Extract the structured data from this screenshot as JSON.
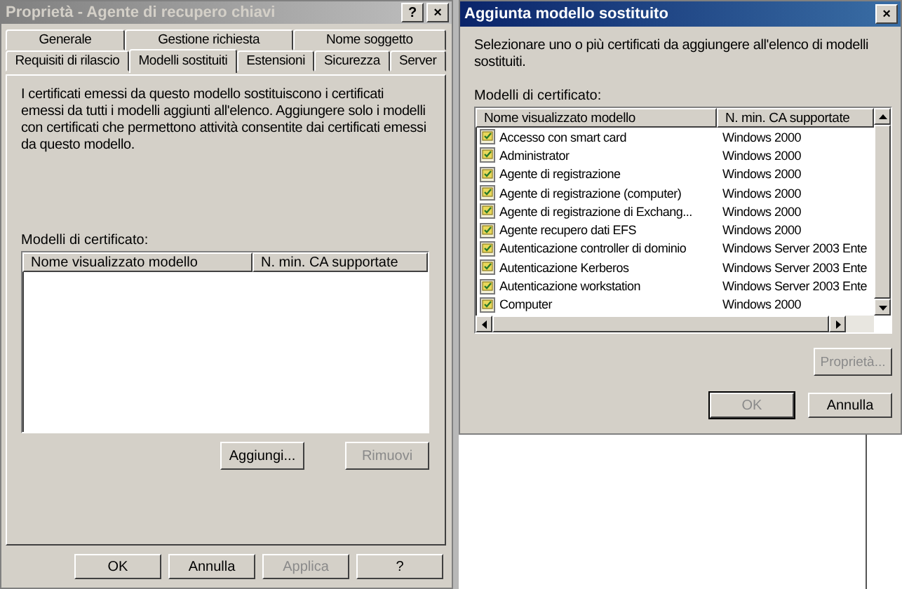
{
  "properties_dialog": {
    "title": "Proprietà - Agente di recupero chiavi",
    "help_button": "?",
    "close_button": "×",
    "tab_rows": [
      [
        {
          "label": "Generale",
          "selected": false
        },
        {
          "label": "Gestione richiesta",
          "selected": false
        },
        {
          "label": "Nome soggetto",
          "selected": false
        }
      ],
      [
        {
          "label": "Requisiti di rilascio",
          "selected": false
        },
        {
          "label": "Modelli sostituiti",
          "selected": true
        },
        {
          "label": "Estensioni",
          "selected": false
        },
        {
          "label": "Sicurezza",
          "selected": false
        },
        {
          "label": "Server",
          "selected": false
        }
      ]
    ],
    "description": "I certificati emessi da questo modello sostituiscono i certificati emessi da tutti i modelli aggiunti all'elenco. Aggiungere solo i modelli con certificati che permettono attività consentite dai certificati emessi da questo modello.",
    "list_label": "Modelli di certificato:",
    "columns": [
      "Nome visualizzato modello",
      "N. min. CA supportate"
    ],
    "list_buttons": [
      {
        "label": "Aggiungi...",
        "disabled": false
      },
      {
        "label": "Rimuovi",
        "disabled": true
      }
    ],
    "buttons": [
      {
        "label": "OK",
        "disabled": false
      },
      {
        "label": "Annulla",
        "disabled": false
      },
      {
        "label": "Applica",
        "disabled": true
      },
      {
        "label": "?",
        "disabled": false
      }
    ]
  },
  "add_dialog": {
    "title": "Aggiunta modello sostituito",
    "close_button": "×",
    "instruction": "Selezionare uno o più certificati da aggiungere all'elenco di modelli sostituiti.",
    "list_label": "Modelli di certificato:",
    "columns": [
      "Nome visualizzato modello",
      "N. min. CA supportate"
    ],
    "rows": [
      {
        "name": "Accesso con smart card",
        "min_ca": "Windows 2000"
      },
      {
        "name": "Administrator",
        "min_ca": "Windows 2000"
      },
      {
        "name": "Agente di registrazione",
        "min_ca": "Windows 2000"
      },
      {
        "name": "Agente di registrazione (computer)",
        "min_ca": "Windows 2000"
      },
      {
        "name": "Agente di registrazione di Exchang...",
        "min_ca": "Windows 2000"
      },
      {
        "name": "Agente recupero dati EFS",
        "min_ca": "Windows 2000"
      },
      {
        "name": "Autenticazione controller di dominio",
        "min_ca": "Windows Server 2003 Ente"
      },
      {
        "name": "Autenticazione Kerberos",
        "min_ca": "Windows Server 2003 Ente"
      },
      {
        "name": "Autenticazione workstation",
        "min_ca": "Windows Server 2003 Ente"
      },
      {
        "name": "Computer",
        "min_ca": "Windows 2000"
      }
    ],
    "properties_button": {
      "label": "Proprietà...",
      "disabled": true
    },
    "buttons": [
      {
        "label": "OK",
        "disabled": true,
        "default": true
      },
      {
        "label": "Annulla",
        "disabled": false,
        "default": false
      }
    ]
  }
}
